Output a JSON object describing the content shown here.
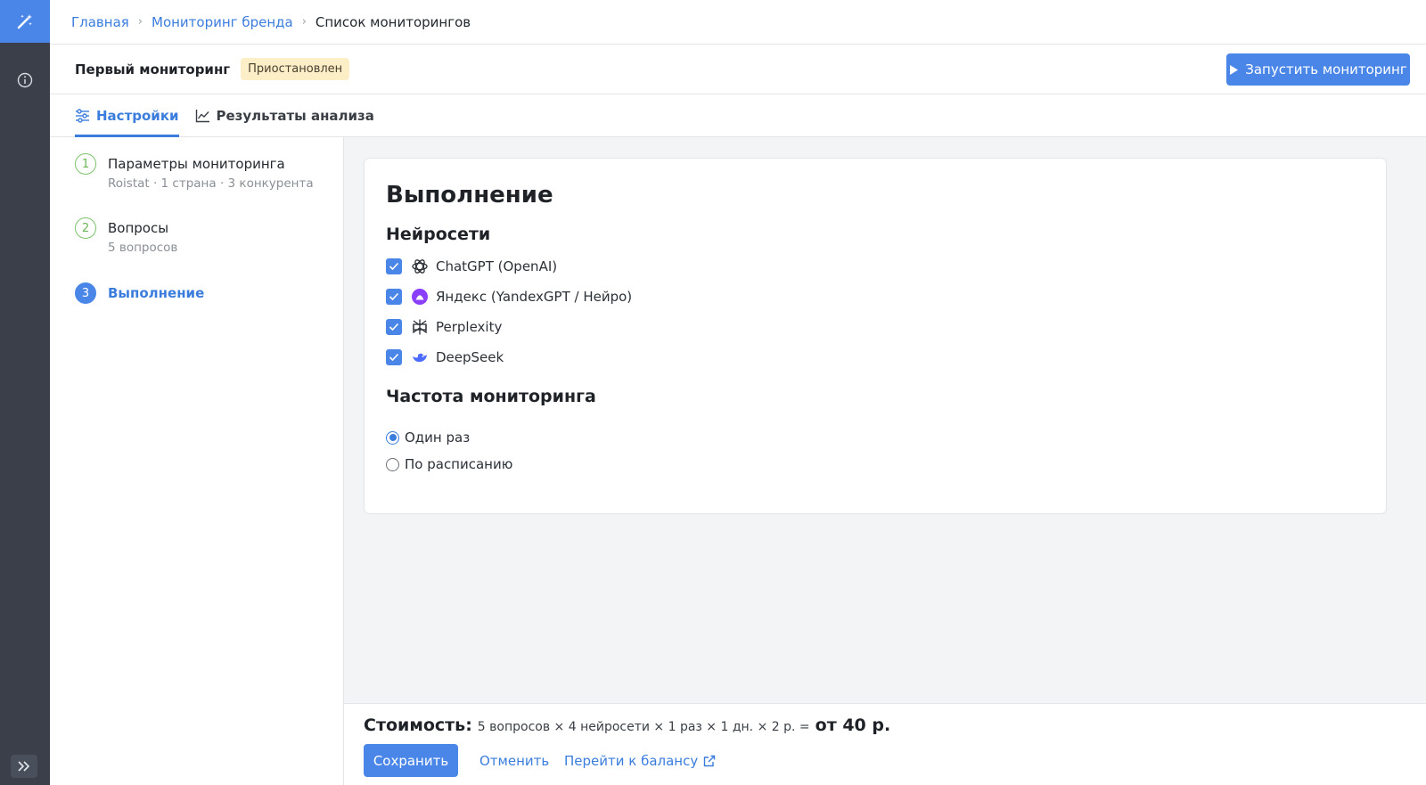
{
  "breadcrumb": {
    "home": "Главная",
    "brand": "Мониторинг бренда",
    "current": "Список мониторингов"
  },
  "header": {
    "title": "Первый мониторинг",
    "status": "Приостановлен",
    "run_label": "Запустить мониторинг"
  },
  "tabs": [
    {
      "label": "Настройки",
      "icon": "sliders-icon"
    },
    {
      "label": "Результаты анализа",
      "icon": "line-chart-icon"
    }
  ],
  "steps": [
    {
      "num": "1",
      "title": "Параметры мониторинга",
      "sub": "Roistat · 1 страна · 3 конкурента"
    },
    {
      "num": "2",
      "title": "Вопросы",
      "sub": "5 вопросов"
    },
    {
      "num": "3",
      "title": "Выполнение",
      "sub": ""
    }
  ],
  "card": {
    "title": "Выполнение",
    "networks_title": "Нейросети",
    "networks": [
      {
        "label": "ChatGPT (OpenAI)",
        "icon": "openai-icon",
        "checked": true
      },
      {
        "label": "Яндекс (YandexGPT / Нейро)",
        "icon": "yandex-icon",
        "checked": true
      },
      {
        "label": "Perplexity",
        "icon": "perplexity-icon",
        "checked": true
      },
      {
        "label": "DeepSeek",
        "icon": "deepseek-icon",
        "checked": true
      }
    ],
    "frequency_title": "Частота мониторинга",
    "frequency": [
      {
        "label": "Один раз",
        "checked": true
      },
      {
        "label": "По расписанию",
        "checked": false
      }
    ]
  },
  "footer": {
    "cost_label": "Стоимость:",
    "cost_formula": "5 вопросов × 4 нейросети × 1 раз × 1 дн. × 2 р. =",
    "cost_total": "от 40 р.",
    "save_label": "Сохранить",
    "cancel_label": "Отменить",
    "balance_label": "Перейти к балансу"
  },
  "colors": {
    "accent": "#4a86e8",
    "rail": "#3b3f4a",
    "badge_bg": "#fcefc7",
    "step_done": "#7cc36a"
  }
}
